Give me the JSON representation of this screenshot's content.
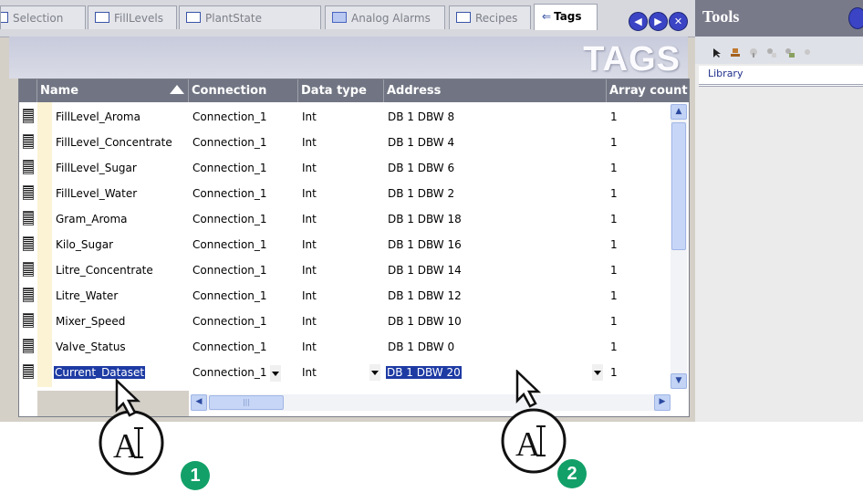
{
  "tabs": [
    {
      "label": "Selection"
    },
    {
      "label": "FillLevels"
    },
    {
      "label": "PlantState"
    },
    {
      "label": "Analog Alarms"
    },
    {
      "label": "Recipes"
    },
    {
      "label": "Tags"
    }
  ],
  "nav": {
    "prev_icon": "◀",
    "next_icon": "▶",
    "close_icon": "✕"
  },
  "heading": "TAGS",
  "columns": [
    "Name",
    "Connection",
    "Data type",
    "Address",
    "Array count"
  ],
  "rows": [
    {
      "name": "FillLevel_Aroma",
      "connection": "Connection_1",
      "type": "Int",
      "address": "DB 1 DBW 8",
      "array": "1"
    },
    {
      "name": "FillLevel_Concentrate",
      "connection": "Connection_1",
      "type": "Int",
      "address": "DB 1 DBW 4",
      "array": "1"
    },
    {
      "name": "FillLevel_Sugar",
      "connection": "Connection_1",
      "type": "Int",
      "address": "DB 1 DBW 6",
      "array": "1"
    },
    {
      "name": "FillLevel_Water",
      "connection": "Connection_1",
      "type": "Int",
      "address": "DB 1 DBW 2",
      "array": "1"
    },
    {
      "name": "Gram_Aroma",
      "connection": "Connection_1",
      "type": "Int",
      "address": "DB 1 DBW 18",
      "array": "1"
    },
    {
      "name": "Kilo_Sugar",
      "connection": "Connection_1",
      "type": "Int",
      "address": "DB 1 DBW 16",
      "array": "1"
    },
    {
      "name": "Litre_Concentrate",
      "connection": "Connection_1",
      "type": "Int",
      "address": "DB 1 DBW 14",
      "array": "1"
    },
    {
      "name": "Litre_Water",
      "connection": "Connection_1",
      "type": "Int",
      "address": "DB 1 DBW 12",
      "array": "1"
    },
    {
      "name": "Mixer_Speed",
      "connection": "Connection_1",
      "type": "Int",
      "address": "DB 1 DBW 10",
      "array": "1"
    },
    {
      "name": "Valve_Status",
      "connection": "Connection_1",
      "type": "Int",
      "address": "DB 1 DBW 0",
      "array": "1"
    }
  ],
  "edit_row": {
    "name": "Current_Dataset",
    "connection": "Connection_1",
    "type": "Int",
    "address": "DB 1 DBW 20",
    "array": "1"
  },
  "tools": {
    "title": "Tools",
    "library_label": "Library"
  },
  "callouts": [
    {
      "label": "1"
    },
    {
      "label": "2"
    }
  ],
  "colors": {
    "selection": "#1e3ba4",
    "header": "#717583",
    "badge": "#12a068",
    "nav_button": "#3a44c4"
  }
}
